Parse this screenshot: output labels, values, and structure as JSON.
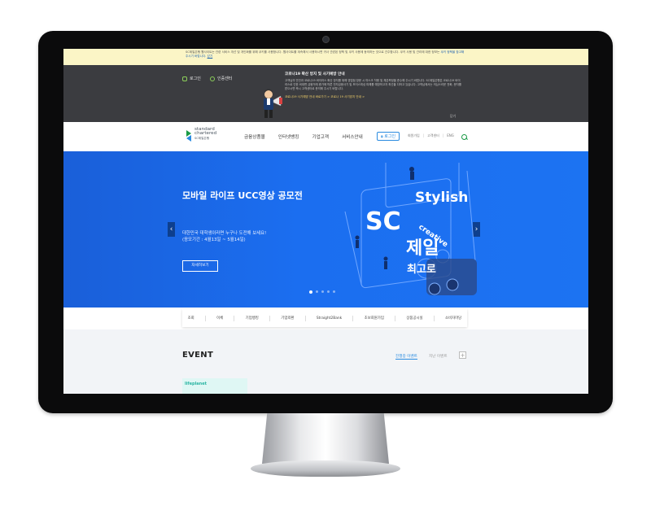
{
  "notice": {
    "text": "SC제일은행 웹사이트는 관련 서비스 개선 및 개인화를 위해 쿠키를 사용합니다. 웹사이트를 계속해서 사용하시면 귀사 관련된 정책 및 쿠키 사용에 동의하는 것으로 간주합니다. 쿠키 사용 및 관리에 대한 정보는",
    "text2": "쿠키 정책을 참고해 주시기 바랍니다.",
    "link": "닫기"
  },
  "topbar": {
    "login": "로그인",
    "cert": "인증센터",
    "notice_title": "코로나19 확산 방지 및 사기예방 안내",
    "notice_body": "고객님의 안전과 코로나19 바이러스 확산 방지를 위해 영업점 방문 시 마스크 착용 및 체온측정을 준수해 주시기 바랍니다. SC제일은행은 코로나19 바이러스로 인한 비대면 금융거래 증가에 따른 전자금융사기 및 보이스피싱 피해를 예방하고자 최선을 다하고 있습니다. 고객님께서는 의심스러운 전화, 문자를 받으시면 즉시 고객센터로 문의해 주시기 바랍니다.",
    "notice_link": "코로나19 사기예방 안내 바로가기 > 코로나 19 사기방지 안내 >",
    "close": "닫기"
  },
  "header": {
    "logo_line1": "standard",
    "logo_line2": "chartered",
    "logo_line3": "SC제일은행",
    "nav": [
      "금융상품몰",
      "인터넷뱅킹",
      "기업고객",
      "서비스안내"
    ],
    "login_button": "로그인",
    "util": [
      "회원가입",
      "고객센터",
      "ENG"
    ]
  },
  "hero": {
    "title": "모바일 라이프 UCC영상 공모전",
    "subtitle_line1": "대한민국 대학생이라면 누구나 도전해 보세요!",
    "subtitle_line2": "(응모기간 : 4월13일 ~ 5월14일)",
    "button": "자세히보기",
    "art_words": [
      "Stylish",
      "SC",
      "creative",
      "제일",
      "최고로"
    ],
    "slide_count": 5,
    "active_slide": 1
  },
  "quickbar": {
    "items": [
      "조회",
      "이체",
      "기업뱅킹",
      "기업외환",
      "Straight2Bank",
      "초보회원가입",
      "상품공시실",
      "소비자마당"
    ]
  },
  "event": {
    "title": "EVENT",
    "tab_active": "진행중 이벤트",
    "tab_other": "지난 이벤트",
    "more": "+",
    "card_logo": "lifeplanet"
  },
  "colors": {
    "accent_blue": "#1c6ef0",
    "brand_green": "#1a9a46",
    "notice_yellow": "#fbf5c6",
    "topbar_dark": "#3b3c40"
  }
}
